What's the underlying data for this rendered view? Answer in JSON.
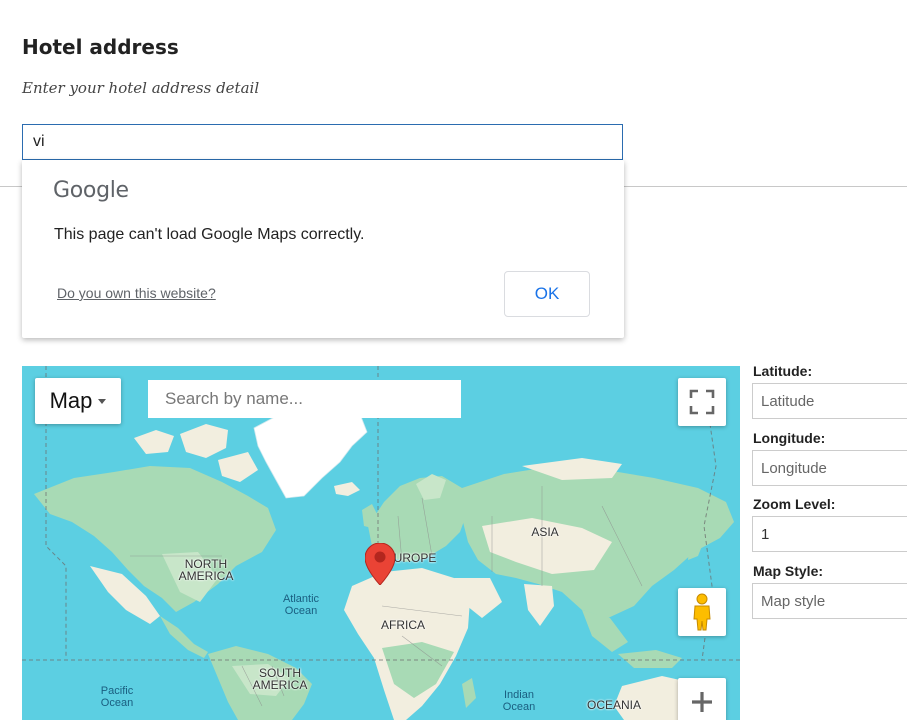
{
  "section": {
    "title": "Hotel address",
    "description": "Enter your hotel address detail"
  },
  "address_input": {
    "value": "vi"
  },
  "maps_error_dialog": {
    "brand": "Google",
    "message": "This page can't load Google Maps correctly.",
    "link_text": "Do you own this website?",
    "ok_label": "OK"
  },
  "map": {
    "type_label": "Map",
    "search_placeholder": "Search by name...",
    "labels": {
      "north_america": "NORTH\nAMERICA",
      "south_america": "SOUTH\nAMERICA",
      "europe": "EUROPE",
      "asia": "ASIA",
      "africa": "AFRICA",
      "oceania": "OCEANIA",
      "atlantic": "Atlantic\nOcean",
      "pacific": "Pacific\nOcean",
      "indian": "Indian\nOcean"
    },
    "controls": {
      "fullscreen_icon": "fullscreen-icon",
      "pegman_icon": "pegman-icon",
      "zoom_in_icon": "plus-icon"
    },
    "colors": {
      "water": "#5ccfe2",
      "land_green": "#a8dab5",
      "land_tan": "#f2eedf",
      "ice": "#ffffff",
      "marker": "#ea4335"
    }
  },
  "side_panel": {
    "latitude_label": "Latitude:",
    "latitude_placeholder": "Latitude",
    "longitude_label": "Longitude:",
    "longitude_placeholder": "Longitude",
    "zoom_label": "Zoom Level:",
    "zoom_value": "1",
    "style_label": "Map Style:",
    "style_placeholder": "Map style"
  }
}
